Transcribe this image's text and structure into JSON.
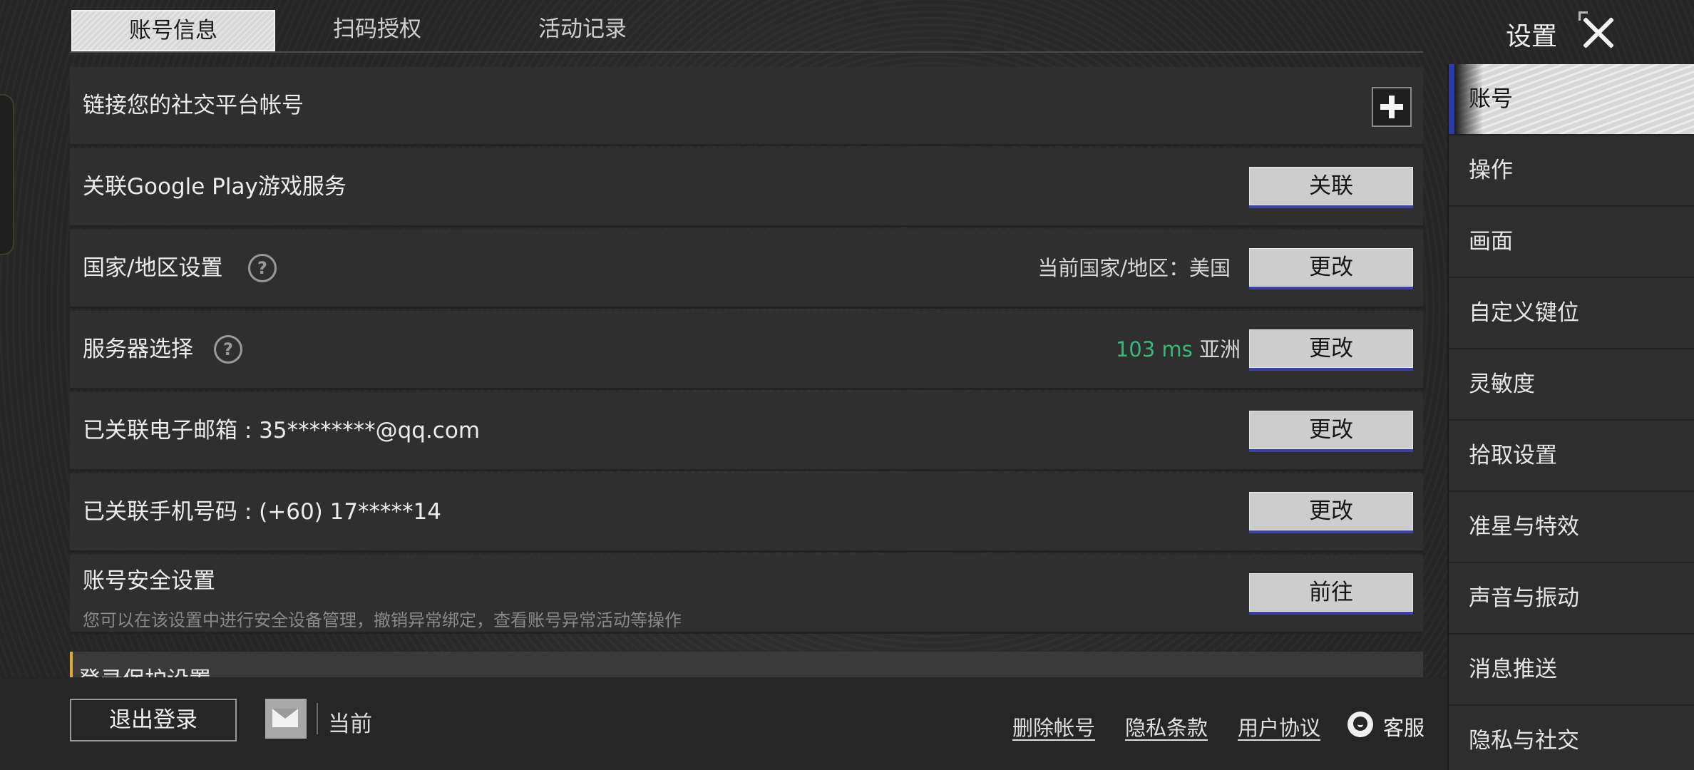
{
  "window_title": "设置",
  "top_tabs": [
    {
      "label": "账号信息",
      "active": true
    },
    {
      "label": "扫码授权",
      "active": false
    },
    {
      "label": "活动记录",
      "active": false
    }
  ],
  "rows": {
    "social": {
      "label": "链接您的社交平台帐号"
    },
    "google": {
      "label": "关联Google Play游戏服务",
      "button": "关联"
    },
    "region": {
      "label": "国家/地区设置",
      "current": "当前国家/地区：美国",
      "button": "更改"
    },
    "server": {
      "label": "服务器选择",
      "ping": "103 ms",
      "region": "亚洲",
      "button": "更改"
    },
    "email": {
      "label": "已关联电子邮箱 : 35********@qq.com",
      "button": "更改"
    },
    "phone": {
      "label": "已关联手机号码 : (+60) 17*****14",
      "button": "更改"
    },
    "security": {
      "label": "账号安全设置",
      "sub": "您可以在该设置中进行安全设备管理，撤销异常绑定，查看账号异常活动等操作",
      "button": "前往"
    }
  },
  "partial_section": "登录保护设置",
  "bottom": {
    "logout": "退出登录",
    "current": "当前",
    "links": [
      "删除帐号",
      "隐私条款",
      "用户协议"
    ],
    "service": "客服"
  },
  "sidebar": [
    {
      "label": "账号",
      "active": true
    },
    {
      "label": "操作"
    },
    {
      "label": "画面"
    },
    {
      "label": "自定义键位"
    },
    {
      "label": "灵敏度"
    },
    {
      "label": "拾取设置"
    },
    {
      "label": "准星与特效"
    },
    {
      "label": "声音与振动"
    },
    {
      "label": "消息推送"
    },
    {
      "label": "隐私与社交"
    }
  ],
  "colors": {
    "ping": "#39b87a",
    "button_underline": "#3f3fa8",
    "section_accent": "#d9a93a"
  }
}
